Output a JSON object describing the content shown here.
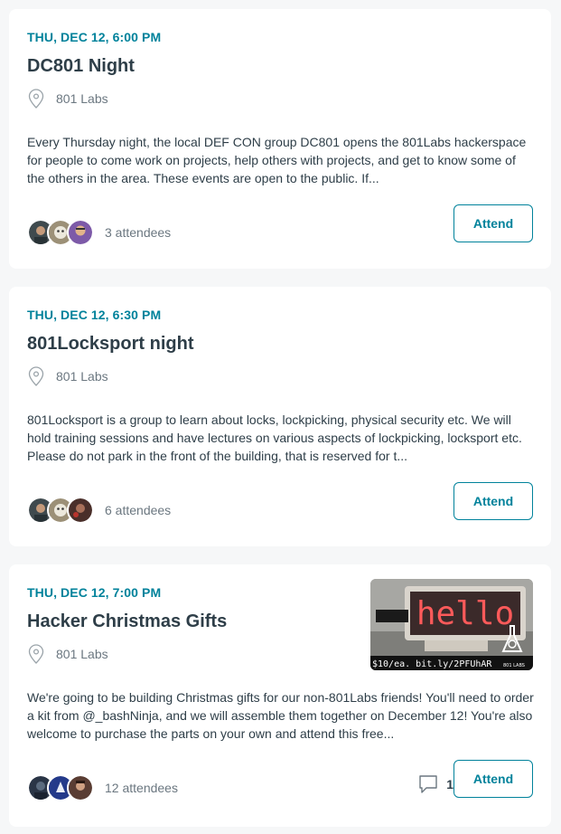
{
  "events": [
    {
      "date": "THU, DEC 12, 6:00 PM",
      "title": "DC801 Night",
      "venue": "801 Labs",
      "description": "Every Thursday night, the local DEF CON group DC801 opens the 801Labs hackerspace for people to come work on projects, help others with projects, and get to know some of the others in the area. These events are open to the public. If...",
      "attendees": "3 attendees",
      "attend_label": "Attend"
    },
    {
      "date": "THU, DEC 12, 6:30 PM",
      "title": "801Locksport night",
      "venue": "801 Labs",
      "description": "801Locksport is a group to learn about locks, lockpicking, physical security etc. We will hold training sessions and have lectures on various aspects of lockpicking, locksport etc. Please do not park in the front of the building, that is reserved for t...",
      "attendees": "6 attendees",
      "attend_label": "Attend"
    },
    {
      "date": "THU, DEC 12, 7:00 PM",
      "title": "Hacker Christmas Gifts",
      "venue": "801 Labs",
      "description": "We're going to be building Christmas gifts for our non-801Labs friends! You'll need to order a kit from @_bashNinja, and we will assemble them together on December 12! You're also welcome to purchase the parts on your own and attend this free...",
      "attendees": "12 attendees",
      "comment_count": "1",
      "attend_label": "Attend",
      "image": {
        "sign_text": "hello",
        "caption": "$10/ea. bit.ly/2PFUhAR",
        "logo_text": "801 LABS"
      }
    }
  ],
  "icons": {
    "venue": "map-pin-icon",
    "comments": "speech-bubble-icon"
  },
  "colors": {
    "accent": "#00829b",
    "text": "#2e3e48",
    "muted": "#6b7780",
    "background": "#f6f7f8"
  }
}
